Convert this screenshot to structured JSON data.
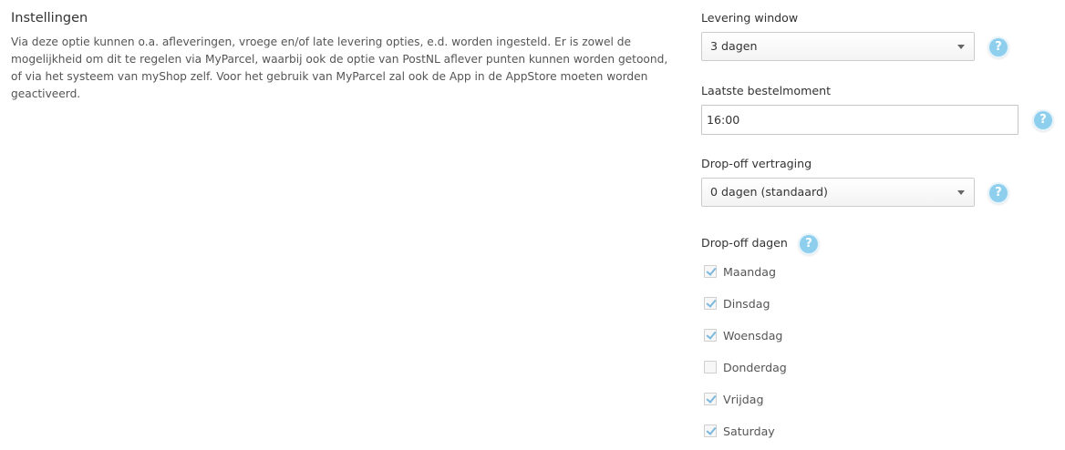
{
  "intro": {
    "title": "Instellingen",
    "description": "Via deze optie kunnen o.a. afleveringen, vroege en/of late levering opties, e.d. worden ingesteld. Er is zowel de mogelijkheid om dit te regelen via MyParcel, waarbij ook de optie van PostNL aflever punten kunnen worden getoond, of via het systeem van myShop zelf. Voor het gebruik van MyParcel zal ook de App in de AppStore moeten worden geactiveerd."
  },
  "delivery_window": {
    "label": "Levering window",
    "selected": "3 dagen",
    "help": "?"
  },
  "last_order": {
    "label": "Laatste bestelmoment",
    "value": "16:00",
    "help": "?"
  },
  "dropoff_delay": {
    "label": "Drop-off vertraging",
    "selected": "0 dagen (standaard)",
    "help": "?"
  },
  "dropoff_days": {
    "label": "Drop-off dagen",
    "help": "?",
    "days": [
      {
        "label": "Maandag",
        "checked": true
      },
      {
        "label": "Dinsdag",
        "checked": true
      },
      {
        "label": "Woensdag",
        "checked": true
      },
      {
        "label": "Donderdag",
        "checked": false
      },
      {
        "label": "Vrijdag",
        "checked": true
      },
      {
        "label": "Saturday",
        "checked": true
      }
    ]
  },
  "colors": {
    "help_badge": "#8ecfee",
    "checkmark": "#7ab8de"
  }
}
